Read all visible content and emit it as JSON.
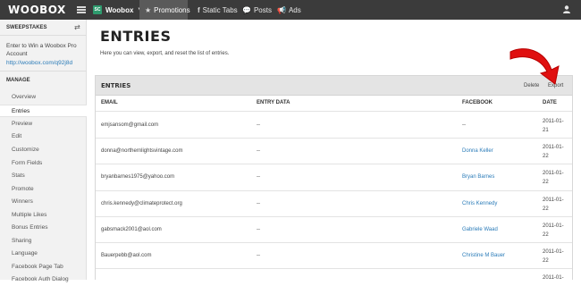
{
  "topnav": {
    "logo": "WOOBOX",
    "account_badge": "SC",
    "account_name": "Woobox",
    "tabs": [
      {
        "label": "Promotions",
        "icon": "star-icon",
        "active": true
      },
      {
        "label": "Static Tabs",
        "icon": "facebook-icon",
        "active": false
      },
      {
        "label": "Posts",
        "icon": "chat-icon",
        "active": false
      },
      {
        "label": "Ads",
        "icon": "megaphone-icon",
        "active": false
      }
    ]
  },
  "sidebar": {
    "section": "SWEEPSTAKES",
    "promo_title": "Enter to Win a Woobox Pro Account",
    "promo_link": "http://woobox.com/q92j8d",
    "manage_label": "MANAGE",
    "items": [
      {
        "label": "Overview"
      },
      {
        "label": "Entries",
        "active": true
      },
      {
        "label": "Preview"
      },
      {
        "label": "Edit"
      },
      {
        "label": "Customize"
      },
      {
        "label": "Form Fields"
      },
      {
        "label": "Stats"
      },
      {
        "label": "Promote"
      },
      {
        "label": "Winners"
      },
      {
        "label": "Multiple Likes"
      },
      {
        "label": "Bonus Entries"
      },
      {
        "label": "Sharing"
      },
      {
        "label": "Language"
      },
      {
        "label": "Facebook Page Tab"
      },
      {
        "label": "Facebook Auth Dialog"
      }
    ]
  },
  "main": {
    "title": "ENTRIES",
    "description": "Here you can view, export, and reset the list of entries.",
    "panel": {
      "title": "ENTRIES",
      "delete_label": "Delete",
      "export_label": "Export",
      "columns": [
        "EMAIL",
        "ENTRY DATA",
        "FACEBOOK",
        "DATE"
      ],
      "rows": [
        {
          "email": "emjsansom@gmail.com",
          "entry_data": "--",
          "facebook": "--",
          "date": "2011-01-21"
        },
        {
          "email": "donna@northernlightsvintage.com",
          "entry_data": "--",
          "facebook": "Donna Keller",
          "date": "2011-01-22"
        },
        {
          "email": "bryanbarnes1975@yahoo.com",
          "entry_data": "--",
          "facebook": "Bryan Barnes",
          "date": "2011-01-22"
        },
        {
          "email": "chris.kennedy@climateprotect.org",
          "entry_data": "--",
          "facebook": "Chris Kennedy",
          "date": "2011-01-22"
        },
        {
          "email": "gabsmack2001@aol.com",
          "entry_data": "--",
          "facebook": "Gabriele Waad",
          "date": "2011-01-22"
        },
        {
          "email": "Bauerpebb@aol.com",
          "entry_data": "--",
          "facebook": "Christine M Bauer",
          "date": "2011-01-22"
        },
        {
          "email": "",
          "entry_data": "",
          "facebook": "",
          "date": "2011-01-"
        }
      ]
    }
  },
  "colors": {
    "topnav_bg": "#3b3b3b",
    "accent_link": "#2a7bb8",
    "annotation_arrow": "#e01010"
  }
}
